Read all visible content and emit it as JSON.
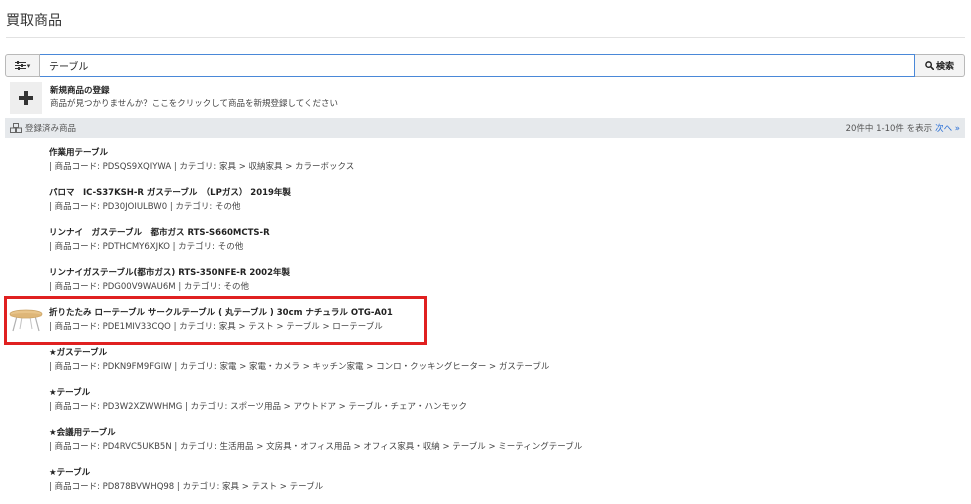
{
  "page": {
    "title": "買取商品"
  },
  "search": {
    "filter_caret": "▾",
    "value": "テーブル",
    "button_label": "検索"
  },
  "new_product": {
    "title": "新規商品の登録",
    "subtitle": "商品が見つかりませんか？ここをクリックして商品を新規登録してください"
  },
  "registered": {
    "label": "登録済み商品",
    "count_text": "20件中 1-10件 を表示",
    "next_label": "次へ »"
  },
  "items": [
    {
      "title": "作業用テーブル",
      "meta": "| 商品コード: PDSQS9XQIYWA | カテゴリ: 家具 > 収納家具 > カラーボックス",
      "has_image": false
    },
    {
      "title": "パロマ　IC-S37KSH-R ガステーブル　（LPガス）  2019年製",
      "meta": "| 商品コード: PD30JOIULBW0 | カテゴリ: その他",
      "has_image": false
    },
    {
      "title": "リンナイ　ガステーブル　都市ガス RTS-S660MCTS-R",
      "meta": "| 商品コード: PDTHCMY6XJKO | カテゴリ: その他",
      "has_image": false
    },
    {
      "title": "リンナイガステーブル(都市ガス) RTS-350NFE-R 2002年製",
      "meta": "| 商品コード: PDG00V9WAU6M | カテゴリ: その他",
      "has_image": false
    },
    {
      "title": "折りたたみ ローテーブル サークルテーブル ( 丸テーブル ) 30cm ナチュラル OTG-A01",
      "meta": "| 商品コード: PDE1MIV33CQO | カテゴリ: 家具 > テスト > テーブル > ローテーブル",
      "has_image": true
    },
    {
      "title": "★ガステーブル",
      "meta": "| 商品コード: PDKN9FM9FGIW | カテゴリ: 家電 > 家電・カメラ > キッチン家電 > コンロ・クッキングヒーター > ガステーブル",
      "has_image": false
    },
    {
      "title": "★テーブル",
      "meta": "| 商品コード: PD3W2XZWWHMG | カテゴリ: スポーツ用品 > アウトドア > テーブル・チェア・ハンモック",
      "has_image": false
    },
    {
      "title": "★会議用テーブル",
      "meta": "| 商品コード: PD4RVC5UKB5N | カテゴリ: 生活用品 > 文房具・オフィス用品 > オフィス家具・収納 > テーブル > ミーティングテーブル",
      "has_image": false
    },
    {
      "title": "★テーブル",
      "meta": "| 商品コード: PD878BVWHQ98 | カテゴリ: 家具 > テスト > テーブル",
      "has_image": false
    }
  ],
  "colors": {
    "accent": "#2a6fd6",
    "highlight": "#e02020",
    "header_bg": "#e6e9ec"
  }
}
